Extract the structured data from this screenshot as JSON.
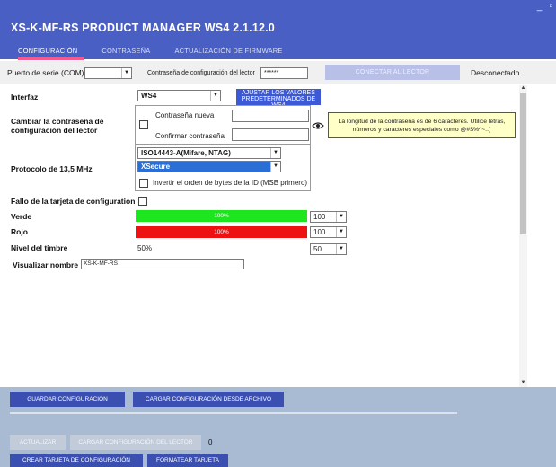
{
  "window": {
    "title": "XS-K-MF-RS  PRODUCT MANAGER WS4 2.1.12.0",
    "minimize_glyph": "_",
    "maximize_glyph": "▫"
  },
  "tabs": [
    {
      "label": "CONFIGURACIÓN"
    },
    {
      "label": "CONTRASEÑA"
    },
    {
      "label": "ACTUALIZACIÓN DE FIRMWARE"
    }
  ],
  "connection": {
    "port_label": "Puerto de serie (COM)",
    "port_value": "",
    "reader_pwd_label": "Contraseña de configuración del lector",
    "reader_pwd_value": "******",
    "connect_button": "CONECTAR AL LECTOR",
    "status": "Desconectado"
  },
  "config": {
    "interface_label": "Interfaz",
    "interface_value": "WS4",
    "defaults_button": "AJUSTAR LOS VALORES PREDETERMINADOS DE WS4",
    "change_pwd_label": "Cambiar la contraseña de configuración del lector",
    "new_pwd_label": "Contraseña nueva",
    "confirm_pwd_label": "Confirmar contraseña",
    "new_pwd_value": "",
    "confirm_pwd_value": "",
    "pwd_info": "La longitud de la contraseña es de 6 caracteres. Utilice letras, números y caracteres especiales como @#$%^~..)",
    "protocol_label": "Protocolo de 13,5 MHz",
    "protocol_value": "ISO14443-A(Mifare, NTAG)",
    "mode_value": "XSecure",
    "invert_label": "Invertir el orden de bytes de la ID (MSB primero)",
    "config_card_fail_label": "Fallo de la tarjeta de configuration",
    "green_label": "Verde",
    "green_bar": "100%",
    "green_value": "100",
    "green_percent": 100,
    "red_label": "Rojo",
    "red_bar": "100%",
    "red_value": "100",
    "red_percent": 100,
    "buzzer_label": "Nivel del timbre",
    "buzzer_text": "50%",
    "buzzer_value": "50",
    "display_name_label": "Visualizar nombre",
    "display_name_value": "XS-K-MF-RS"
  },
  "footer": {
    "save_button": "GUARDAR CONFIGURACIÓN",
    "load_file_button": "CARGAR CONFIGURACIÓN DESDE ARCHIVO",
    "update_button": "ACTUALIZAR",
    "load_reader_button": "CARGAR CONFIGURACIÓN DEL LECTOR",
    "counter": "0",
    "create_card_button": "CREAR TARJETA DE CONFIGURACIÓN",
    "format_card_button": "FORMATEAR TARJETA"
  },
  "colors": {
    "title_bar": "#4a5fc4",
    "accent_pink": "#f35a8f",
    "green": "#1ee61e",
    "red": "#ee1111",
    "footer": "#a9bad3",
    "button_blue": "#3b4fb0"
  }
}
